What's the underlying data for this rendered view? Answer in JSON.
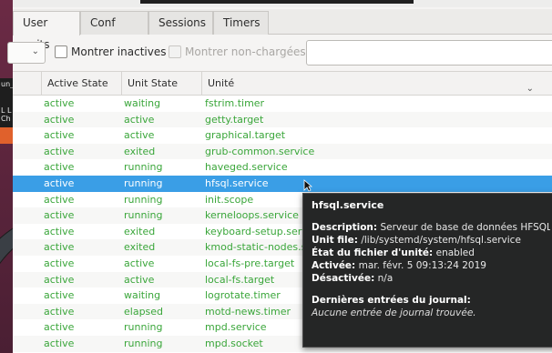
{
  "background": {
    "fragments": [
      "un_e",
      "L L",
      "Ch"
    ]
  },
  "tabs": [
    {
      "label": "User units",
      "active": true
    },
    {
      "label": "Conf",
      "active": false
    },
    {
      "label": "Sessions",
      "active": false
    },
    {
      "label": "Timers",
      "active": false
    }
  ],
  "toolbar": {
    "show_inactive_label": "Montrer inactives",
    "show_unloaded_label": "Montrer non-chargées",
    "search_value": ""
  },
  "table": {
    "headers": {
      "active_state": "Active State",
      "unit_state": "Unit State",
      "unit": "Unité"
    },
    "rows": [
      {
        "active": "active",
        "state": "waiting",
        "unit": "fstrim.timer"
      },
      {
        "active": "active",
        "state": "active",
        "unit": "getty.target"
      },
      {
        "active": "active",
        "state": "active",
        "unit": "graphical.target"
      },
      {
        "active": "active",
        "state": "exited",
        "unit": "grub-common.service"
      },
      {
        "active": "active",
        "state": "running",
        "unit": "haveged.service"
      },
      {
        "active": "active",
        "state": "running",
        "unit": "hfsql.service"
      },
      {
        "active": "active",
        "state": "running",
        "unit": "init.scope"
      },
      {
        "active": "active",
        "state": "running",
        "unit": "kerneloops.service"
      },
      {
        "active": "active",
        "state": "exited",
        "unit": "keyboard-setup.service"
      },
      {
        "active": "active",
        "state": "exited",
        "unit": "kmod-static-nodes.service"
      },
      {
        "active": "active",
        "state": "active",
        "unit": "local-fs-pre.target"
      },
      {
        "active": "active",
        "state": "active",
        "unit": "local-fs.target"
      },
      {
        "active": "active",
        "state": "waiting",
        "unit": "logrotate.timer"
      },
      {
        "active": "active",
        "state": "elapsed",
        "unit": "motd-news.timer"
      },
      {
        "active": "active",
        "state": "running",
        "unit": "mpd.service"
      },
      {
        "active": "active",
        "state": "running",
        "unit": "mpd.socket"
      }
    ],
    "selected_index": 5
  },
  "tooltip": {
    "title": "hfsql.service",
    "description_label": "Description:",
    "description_value": "Serveur de base de données HFSQL",
    "unit_file_label": "Unit file:",
    "unit_file_value": "/lib/systemd/system/hfsql.service",
    "file_state_label": "État du fichier d'unité:",
    "file_state_value": "enabled",
    "activated_label": "Activée:",
    "activated_value": "mar. févr. 5 09:13:24 2019",
    "deactivated_label": "Désactivée:",
    "deactivated_value": "n/a",
    "journal_title": "Dernières entrées du journal:",
    "journal_empty": "Aucune entrée de journal trouvée."
  },
  "colors": {
    "row_text": "#3aa63a",
    "selected_row": "#3a9ee6",
    "tooltip_bg": "#252626"
  }
}
